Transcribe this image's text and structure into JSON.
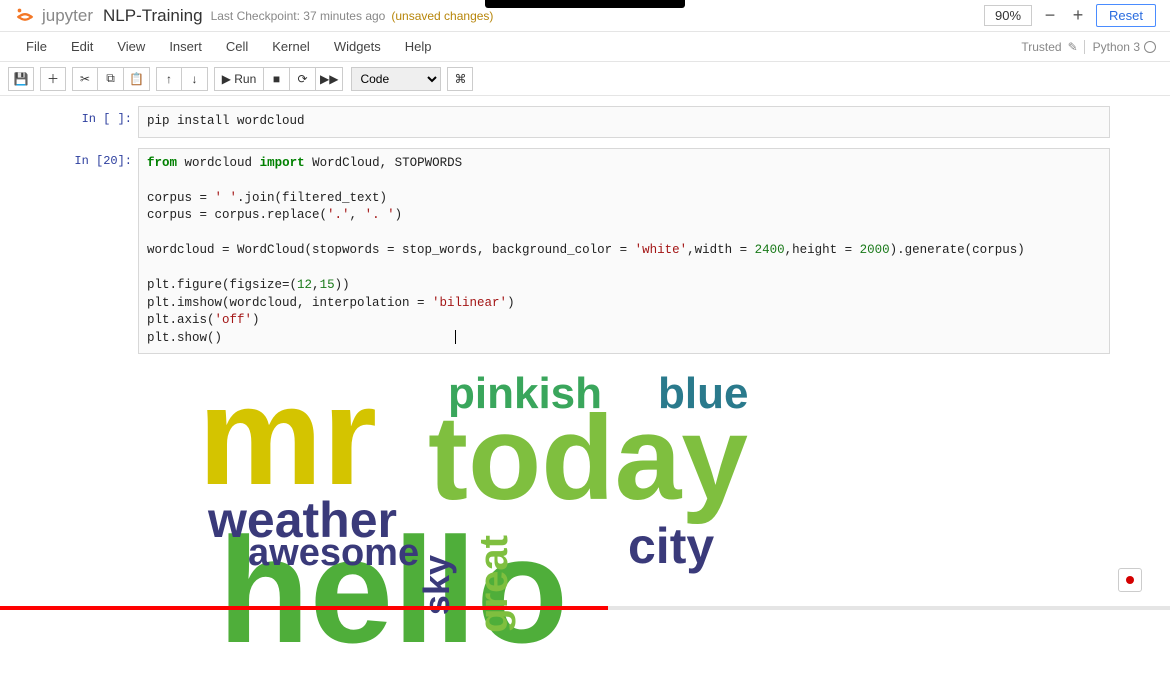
{
  "brand": "jupyter",
  "notebook_name": "NLP-Training",
  "checkpoint": "Last Checkpoint: 37 minutes ago",
  "unsaved": "(unsaved changes)",
  "zoom": {
    "value": "90%",
    "reset": "Reset"
  },
  "menu": [
    "File",
    "Edit",
    "View",
    "Insert",
    "Cell",
    "Kernel",
    "Widgets",
    "Help"
  ],
  "trusted": "Trusted",
  "kernel": "Python 3",
  "toolbar": {
    "save": "💾",
    "add": "＋",
    "cut": "✂",
    "copy": "⧉",
    "paste": "📋",
    "up": "↑",
    "down": "↓",
    "run": "▶ Run",
    "stop": "■",
    "restart": "⟳",
    "ff": "▶▶",
    "celltype": "Code",
    "cmd": "⌘"
  },
  "cells": {
    "c1": {
      "prompt": "In [ ]:",
      "line1": "pip install wordcloud"
    },
    "c2": {
      "prompt": "In [20]:",
      "l1a": "from",
      "l1b": "wordcloud",
      "l1c": "import",
      "l1d": "WordCloud, STOPWORDS",
      "l2a": "corpus = ",
      "l2b": "' '",
      "l2c": ".join(filtered_text)",
      "l3a": "corpus = corpus.replace(",
      "l3b": "'.'",
      "l3c": ", ",
      "l3d": "'. '",
      "l3e": ")",
      "l4a": "wordcloud = WordCloud(stopwords = stop_words, background_color = ",
      "l4b": "'white'",
      "l4c": ",width = ",
      "l4d": "2400",
      "l4e": ",height = ",
      "l4f": "2000",
      "l4g": ").generate(corpus)",
      "l5a": "plt.figure(figsize=(",
      "l5b": "12",
      "l5c": ",",
      "l5d": "15",
      "l5e": "))",
      "l6a": "plt.imshow(wordcloud, interpolation = ",
      "l6b": "'bilinear'",
      "l6c": ")",
      "l7a": "plt.axis(",
      "l7b": "'off'",
      "l7c": ")",
      "l8": "plt.show()"
    }
  },
  "wordcloud": {
    "w1": {
      "text": "mr",
      "color": "#d4c400"
    },
    "w2": {
      "text": "today",
      "color": "#7fbf3f"
    },
    "w3": {
      "text": "hello",
      "color": "#4fae3a"
    },
    "w4": {
      "text": "pinkish",
      "color": "#3aa65c"
    },
    "w5": {
      "text": "blue",
      "color": "#2a7a8c"
    },
    "w6": {
      "text": "weather",
      "color": "#3a3a7a"
    },
    "w7": {
      "text": "awesome",
      "color": "#3a3a7a"
    },
    "w8": {
      "text": "city",
      "color": "#3a3a7a"
    },
    "w9": {
      "text": "great",
      "color": "#7fbf3f"
    },
    "w10": {
      "text": "sky",
      "color": "#3a3a7a"
    }
  }
}
